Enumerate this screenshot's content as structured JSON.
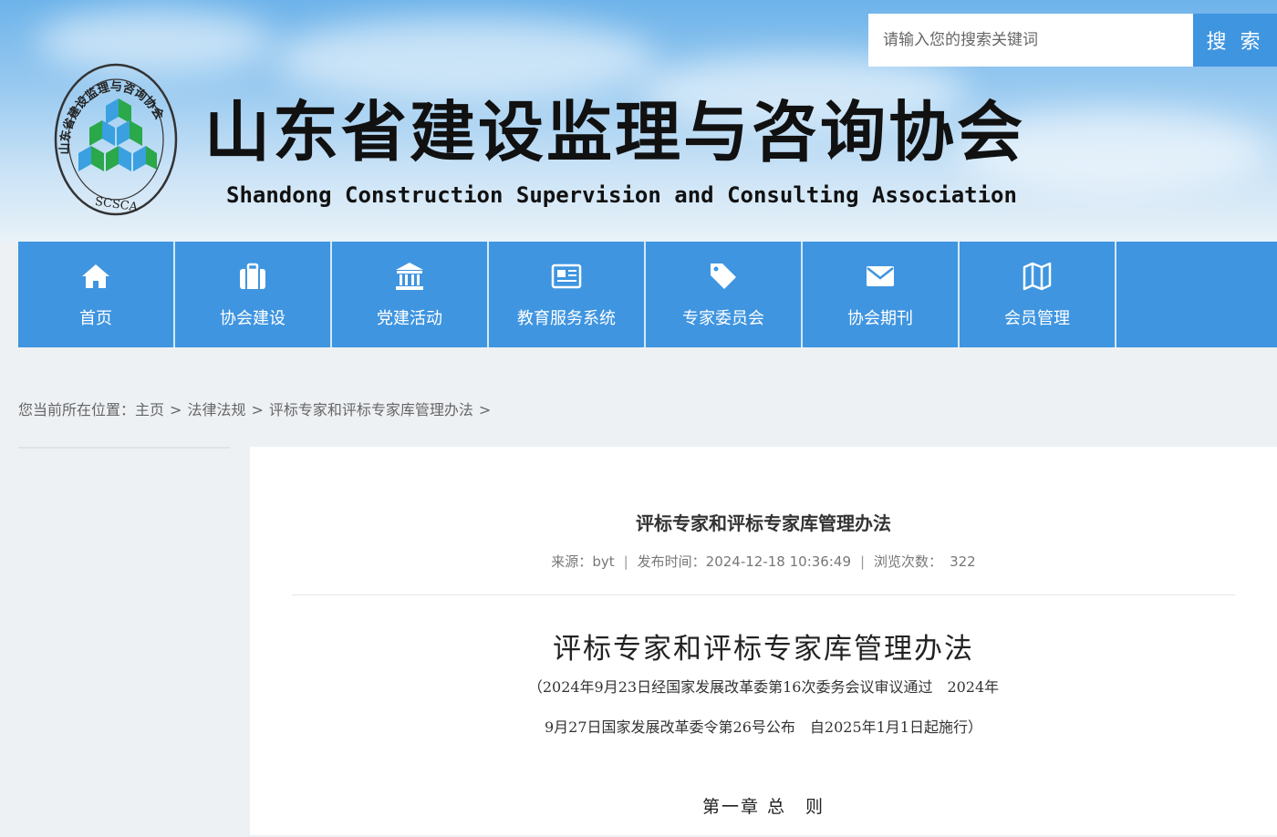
{
  "header": {
    "title_cn": "山东省建设监理与咨询协会",
    "title_en": "Shandong Construction Supervision and Consulting Association",
    "logo_text": "山东省建设监理与咨询协会",
    "logo_abbr": "SCSCA"
  },
  "search": {
    "placeholder": "请输入您的搜索关键词",
    "button_label": "搜 索"
  },
  "nav": {
    "items": [
      {
        "label": "首页",
        "icon": "home-icon"
      },
      {
        "label": "协会建设",
        "icon": "briefcase-icon"
      },
      {
        "label": "党建活动",
        "icon": "institution-icon"
      },
      {
        "label": "教育服务系统",
        "icon": "newspaper-icon"
      },
      {
        "label": "专家委员会",
        "icon": "tag-icon"
      },
      {
        "label": "协会期刊",
        "icon": "envelope-icon"
      },
      {
        "label": "会员管理",
        "icon": "map-icon"
      }
    ]
  },
  "breadcrumb": {
    "prefix": "您当前所在位置：",
    "items": [
      "主页",
      "法律法规",
      "评标专家和评标专家库管理办法"
    ],
    "separator": ">"
  },
  "article": {
    "title": "评标专家和评标专家库管理办法",
    "source_label": "来源：",
    "source": "byt",
    "date_label": "发布时间：",
    "date": "2024-12-18 10:36:49",
    "views_label": "浏览次数：",
    "views": "322",
    "doc_title": "评标专家和评标专家库管理办法",
    "doc_sub_line1": "（2024年9月23日经国家发展改革委第16次委务会议审议通过　2024年",
    "doc_sub_line2": "9月27日国家发展改革委令第26号公布　自2025年1月1日起施行）",
    "chapter": "第一章 总　则"
  },
  "colors": {
    "nav_bg": "#3f95e0",
    "search_button": "#3f95e0",
    "logo_green": "#2aa84a",
    "logo_blue": "#3aa0e0"
  }
}
